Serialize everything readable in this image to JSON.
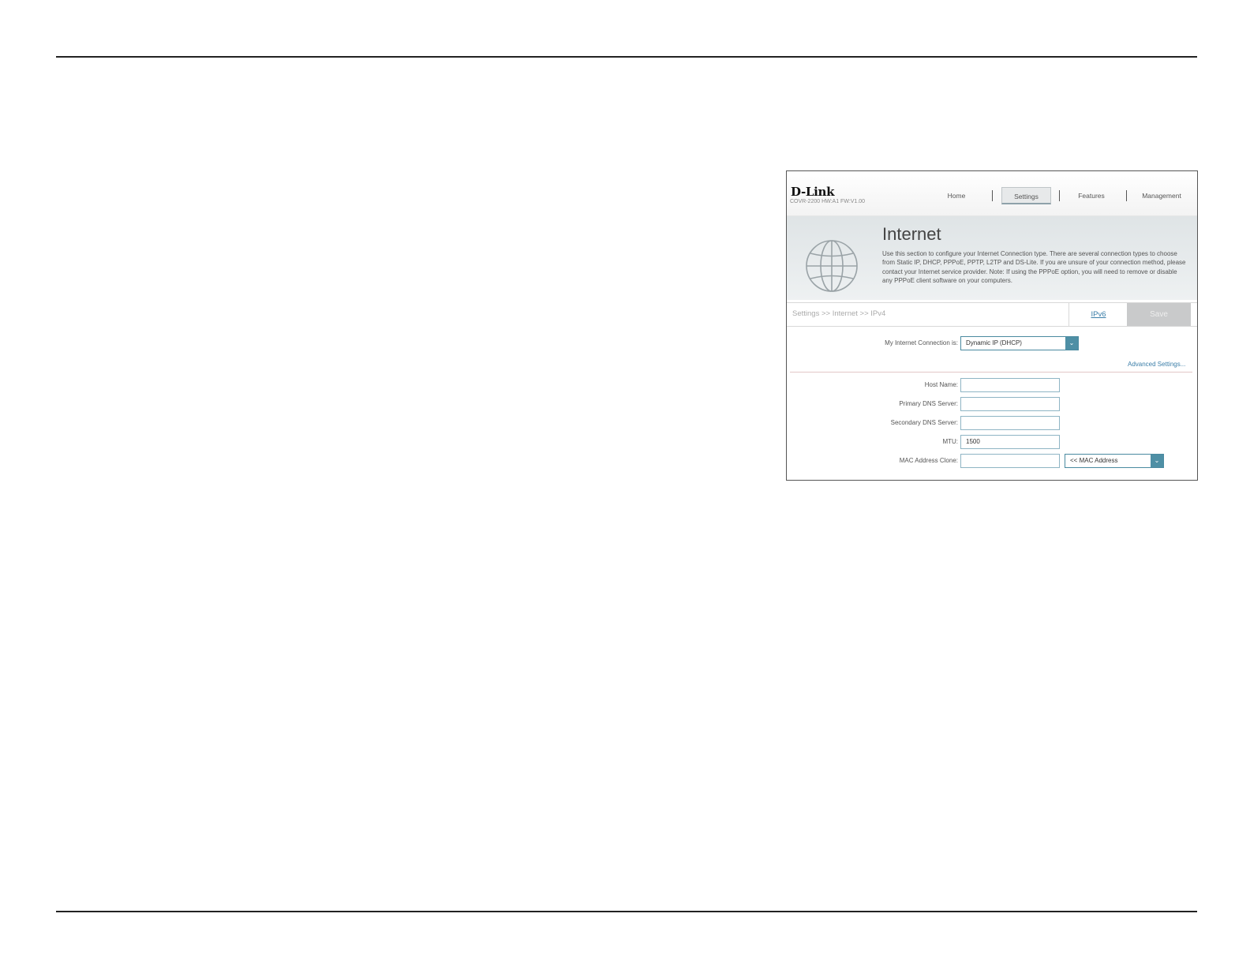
{
  "router": {
    "brand": "D-Link",
    "model": "COVR-2200 HW:A1 FW:V1.00",
    "nav": [
      {
        "label": "Home",
        "active": false
      },
      {
        "label": "Settings",
        "active": true
      },
      {
        "label": "Features",
        "active": false
      },
      {
        "label": "Management",
        "active": false
      }
    ],
    "hero": {
      "title": "Internet",
      "description": "Use this section to configure your Internet Connection type. There are several connection types to choose from Static IP, DHCP, PPPoE, PPTP, L2TP and DS-Lite. If you are unsure of your connection method, please contact your Internet service provider. Note: If using the PPPoE option, you will need to remove or disable any PPPoE client software on your computers.",
      "icon": "globe-icon"
    },
    "breadcrumb": "Settings >> Internet >> IPv4",
    "ipv6_link": "IPv6",
    "save_label": "Save",
    "connection": {
      "label": "My Internet Connection is:",
      "value": "Dynamic IP (DHCP)"
    },
    "advanced_link": "Advanced Settings...",
    "fields": [
      {
        "label": "Host Name:",
        "value": ""
      },
      {
        "label": "Primary DNS Server:",
        "value": ""
      },
      {
        "label": "Secondary DNS Server:",
        "value": ""
      },
      {
        "label": "MTU:",
        "value": "1500"
      },
      {
        "label": "MAC Address Clone:",
        "value": ""
      }
    ],
    "mac_select": "<< MAC Address",
    "colors": {
      "accent": "#4e8fa5",
      "link": "#3b7ea8",
      "save_disabled": "#c9cacb"
    }
  }
}
